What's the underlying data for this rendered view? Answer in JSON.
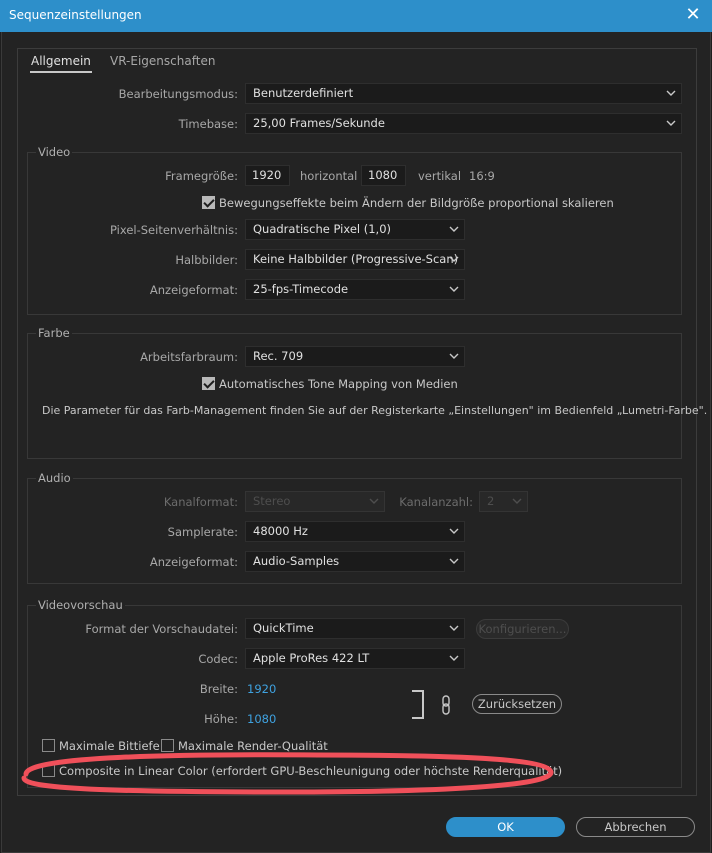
{
  "window": {
    "title": "Sequenzeinstellungen",
    "close_glyph": "✕"
  },
  "tabs": [
    {
      "label": "Allgemein",
      "active": true
    },
    {
      "label": "VR-Eigenschaften",
      "active": false
    }
  ],
  "general": {
    "edit_mode_label": "Bearbeitungsmodus:",
    "edit_mode_value": "Benutzerdefiniert",
    "timebase_label": "Timebase:",
    "timebase_value": "25,00  Frames/Sekunde"
  },
  "video": {
    "title": "Video",
    "frame_size_label": "Framegröße:",
    "width_value": "1920",
    "horizontal_label": "horizontal",
    "height_value": "1080",
    "vertical_label": "vertikal",
    "aspect": "16:9",
    "scale_checkbox_label": "Bewegungseffekte beim Ändern der Bildgröße proportional skalieren",
    "scale_checked": true,
    "pixel_aspect_label": "Pixel-Seitenverhältnis:",
    "pixel_aspect_value": "Quadratische Pixel (1,0)",
    "fields_label": "Halbbilder:",
    "fields_value": "Keine Halbbilder (Progressive-Scan)",
    "display_format_label": "Anzeigeformat:",
    "display_format_value": "25-fps-Timecode"
  },
  "color": {
    "title": "Farbe",
    "working_space_label": "Arbeitsfarbraum:",
    "working_space_value": "Rec. 709",
    "tone_mapping_label": "Automatisches Tone Mapping von Medien",
    "tone_mapping_checked": true,
    "info_text": "Die Parameter für das Farb-Management finden Sie auf der Registerkarte „Einstellungen\" im Bedienfeld „Lumetri-Farbe\"."
  },
  "audio": {
    "title": "Audio",
    "channel_format_label": "Kanalformat:",
    "channel_format_value": "Stereo",
    "channel_count_label": "Kanalanzahl:",
    "channel_count_value": "2",
    "sample_rate_label": "Samplerate:",
    "sample_rate_value": "48000 Hz",
    "display_format_label": "Anzeigeformat:",
    "display_format_value": "Audio-Samples"
  },
  "preview": {
    "title": "Videovorschau",
    "format_label": "Format der Vorschaudatei:",
    "format_value": "QuickTime",
    "configure_label": "Konfigurieren...",
    "codec_label": "Codec:",
    "codec_value": "Apple ProRes 422 LT",
    "width_label": "Breite:",
    "width_value": "1920",
    "height_label": "Höhe:",
    "height_value": "1080",
    "reset_label": "Zurücksetzen",
    "max_bit_depth_label": "Maximale Bittiefe",
    "max_render_quality_label": "Maximale Render-Qualität",
    "linear_color_label": "Composite in Linear Color (erfordert GPU-Beschleunigung oder höchste Renderqualität)",
    "max_bit_depth_checked": false,
    "max_render_quality_checked": false,
    "linear_color_checked": false
  },
  "footer": {
    "ok_label": "OK",
    "cancel_label": "Abbrechen"
  },
  "colors": {
    "accent": "#2d8fca",
    "annotation": "#f0505a",
    "value_blue": "#3fa2e0"
  },
  "icons": [
    "close-icon",
    "chevron-down-icon",
    "checkmark-icon",
    "chain-link-icon"
  ]
}
